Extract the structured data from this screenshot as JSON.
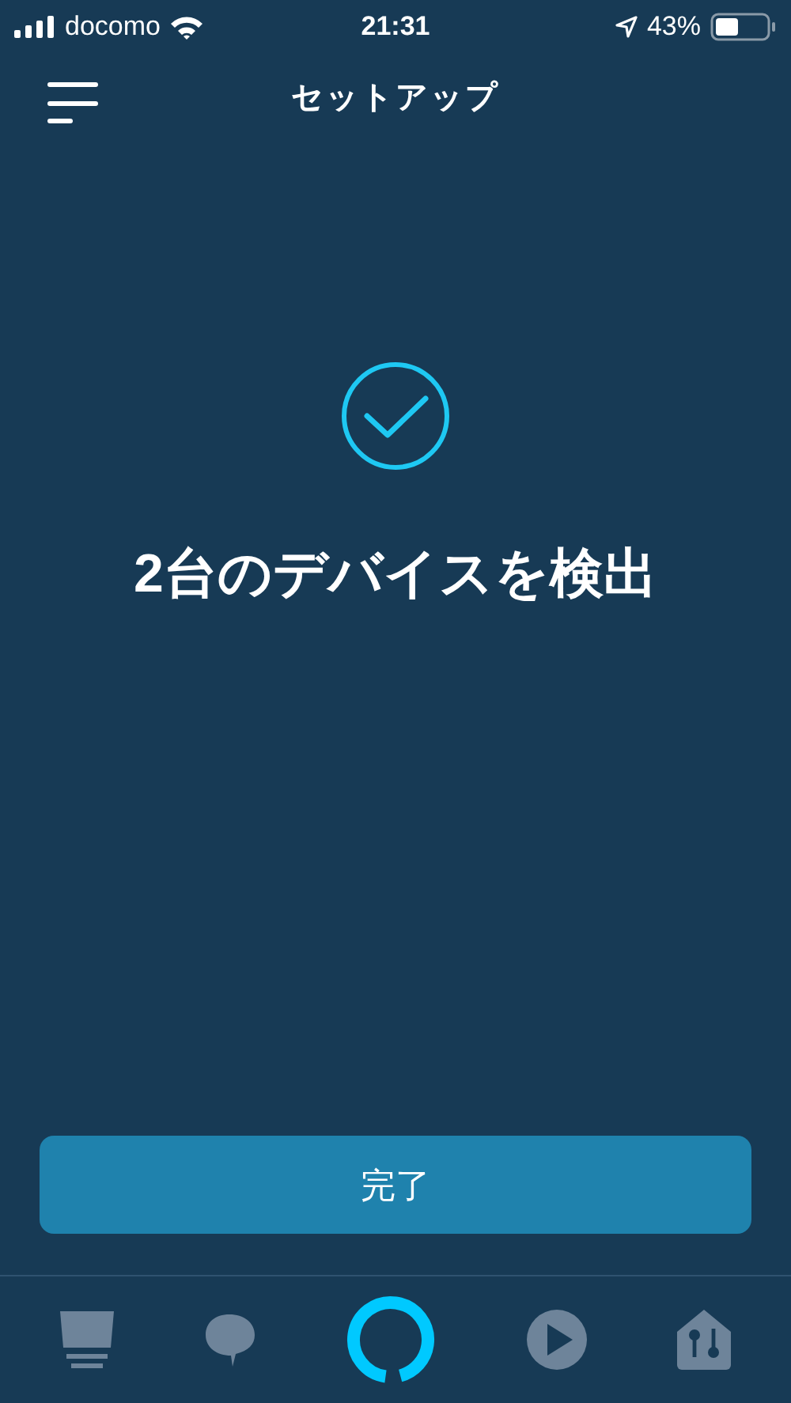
{
  "status_bar": {
    "carrier": "docomo",
    "time": "21:31",
    "battery": "43%"
  },
  "header": {
    "title": "セットアップ"
  },
  "result": {
    "message": "2台のデバイスを検出"
  },
  "done_button": {
    "label": "完了"
  }
}
